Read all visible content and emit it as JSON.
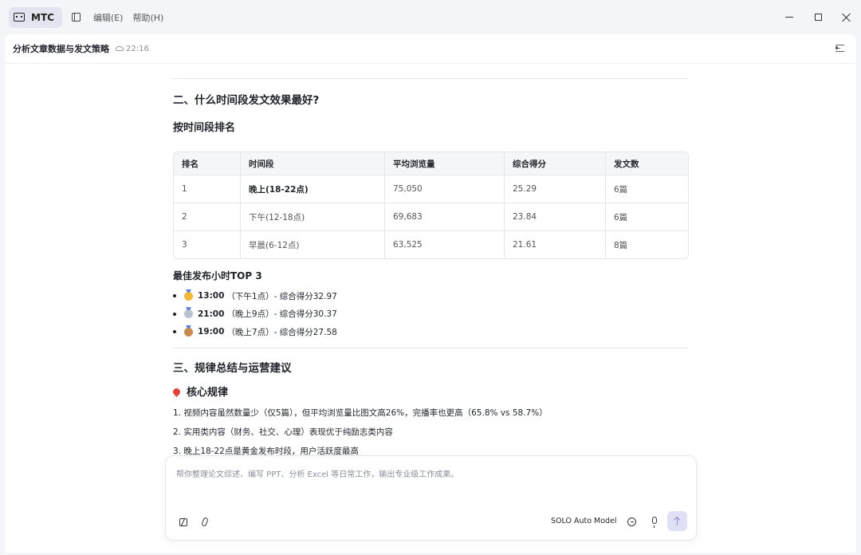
{
  "app": {
    "name": "MTC"
  },
  "menu": {
    "edit": "编辑(E)",
    "help": "帮助(H)"
  },
  "doc": {
    "title": "分析文章数据与发文策略",
    "time": "22:16"
  },
  "section2": {
    "heading": "二、什么时间段发文效果最好?",
    "ranking_heading": "按时间段排名",
    "table": {
      "headers": [
        "排名",
        "时间段",
        "平均浏览量",
        "综合得分",
        "发文数"
      ],
      "rows": [
        [
          "1",
          "晚上(18-22点)",
          "75,050",
          "25.29",
          "6篇"
        ],
        [
          "2",
          "下午(12-18点)",
          "69,683",
          "23.84",
          "6篇"
        ],
        [
          "3",
          "早晨(6-12点)",
          "63,525",
          "21.61",
          "8篇"
        ]
      ]
    },
    "top3_heading": "最佳发布小时TOP 3",
    "top3": [
      {
        "time": "13:00",
        "rest": "（下午1点）- 综合得分32.97",
        "medal": "gold"
      },
      {
        "time": "21:00",
        "rest": "（晚上9点）- 综合得分30.37",
        "medal": "silver"
      },
      {
        "time": "19:00",
        "rest": "（晚上7点）- 综合得分27.58",
        "medal": "bronze"
      }
    ]
  },
  "section3": {
    "heading": "三、规律总结与运营建议",
    "core_heading": "核心规律",
    "rules": [
      "1. 视频内容虽然数量少（仅5篇），但平均浏览量比图文高26%，完播率也更高（65.8% vs 58.7%）",
      "2. 实用类内容（财务、社交、心理）表现优于纯励志类内容",
      "3. 晚上18-22点是黄金发布时段，用户活跃度最高"
    ]
  },
  "input": {
    "placeholder": "帮你整理论文综述、编写 PPT、分析 Excel 等日常工作，输出专业级工作成果。",
    "model": "SOLO Auto Model"
  },
  "colors": {
    "accent": "#dfe0f5",
    "titlebar_bg": "#f4f5f8",
    "badge_bg": "#e3e4ef"
  }
}
